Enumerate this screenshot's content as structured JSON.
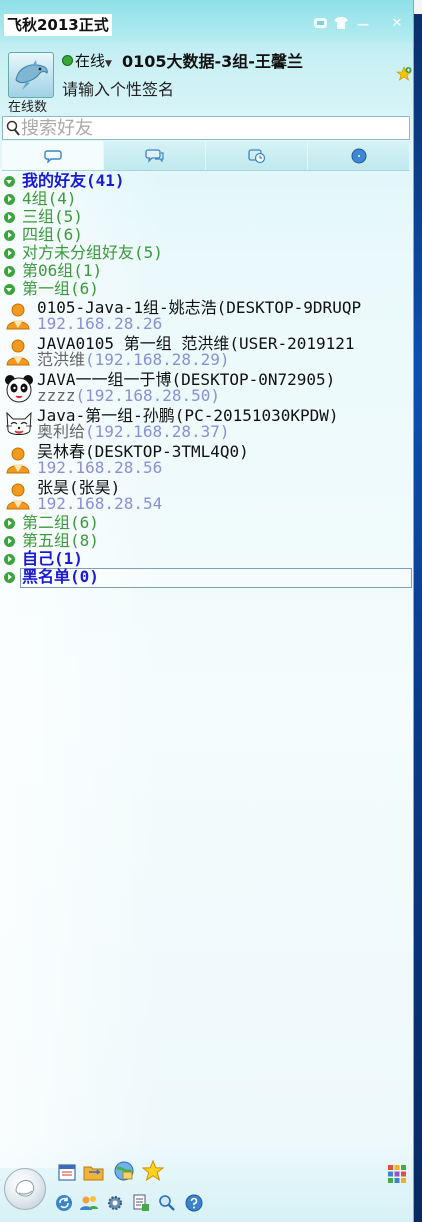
{
  "app": {
    "title": "飞秋2013正式",
    "minimize": "—",
    "close": "✕"
  },
  "profile": {
    "status": "在线",
    "username": "0105大数据-3组-王馨兰",
    "signature": "请输入个性签名",
    "online_label": "在线数"
  },
  "search": {
    "placeholder": "搜索好友"
  },
  "tabs": [
    {
      "name": "chat-icon",
      "active": true
    },
    {
      "name": "group-chat-icon",
      "active": false
    },
    {
      "name": "recent-icon",
      "active": false
    },
    {
      "name": "compass-icon",
      "active": false
    }
  ],
  "list": [
    {
      "type": "group",
      "label": "我的好友(41)",
      "open": true,
      "bold": true
    },
    {
      "type": "group",
      "label": "4组(4)",
      "open": false
    },
    {
      "type": "group",
      "label": "三组(5)",
      "open": false
    },
    {
      "type": "group",
      "label": "四组(6)",
      "open": false
    },
    {
      "type": "group",
      "label": "对方未分组好友(5)",
      "open": false
    },
    {
      "type": "group",
      "label": "第06组(1)",
      "open": false
    },
    {
      "type": "group",
      "label": "第一组(6)",
      "open": true
    },
    {
      "type": "contact",
      "avatar": "person-icon",
      "name": "0105-Java-1组-姚志浩(DESKTOP-9DRUQP",
      "sub_nick": "",
      "sub_ip": "192.168.28.26"
    },
    {
      "type": "contact",
      "avatar": "person-icon",
      "name": "JAVA0105 第一组 范洪维(USER-2019121",
      "sub_nick": "范洪维",
      "sub_ip": "(192.168.28.29)"
    },
    {
      "type": "contact",
      "avatar": "panda-icon",
      "name": "JAVA一一组一于博(DESKTOP-0N72905)",
      "sub_nick": "zzzz",
      "sub_ip": "(192.168.28.50)"
    },
    {
      "type": "contact",
      "avatar": "cat-icon",
      "name": "Java-第一组-孙鹏(PC-20151030KPDW)",
      "sub_nick": "奥利给",
      "sub_ip": "(192.168.28.37)"
    },
    {
      "type": "contact",
      "avatar": "person-icon",
      "name": "吴林春(DESKTOP-3TML4Q0)",
      "sub_nick": "",
      "sub_ip": "192.168.28.56"
    },
    {
      "type": "contact",
      "avatar": "person-icon",
      "name": "张昊(张昊)",
      "sub_nick": "",
      "sub_ip": "192.168.28.54"
    },
    {
      "type": "group",
      "label": "第二组(6)",
      "open": false
    },
    {
      "type": "group",
      "label": "第五组(8)",
      "open": false
    },
    {
      "type": "group",
      "label": "自己(1)",
      "open": false,
      "bold": true
    },
    {
      "type": "group",
      "label": "黑名单(0)",
      "open": false,
      "bold": true,
      "selected": true
    }
  ],
  "colors": {
    "group_text": "#3b9a3c",
    "bold_group_text": "#1a1ad6",
    "ip_text": "#8b8fd6"
  }
}
